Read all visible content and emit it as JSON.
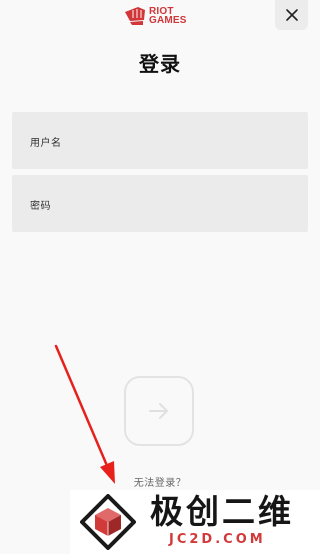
{
  "brand": {
    "line1": "RIOT",
    "line2": "GAMES",
    "color": "#d13639"
  },
  "header": {
    "close_icon": "close-icon"
  },
  "title": "登录",
  "fields": {
    "username": {
      "label": "用户名",
      "value": ""
    },
    "password": {
      "label": "密码",
      "value": ""
    }
  },
  "submit": {
    "icon": "arrow-right-icon"
  },
  "cant_login": "无法登录？",
  "watermark": {
    "cn": "极创二维",
    "en": "JC2D.COM",
    "accent": "#d23a3a"
  }
}
